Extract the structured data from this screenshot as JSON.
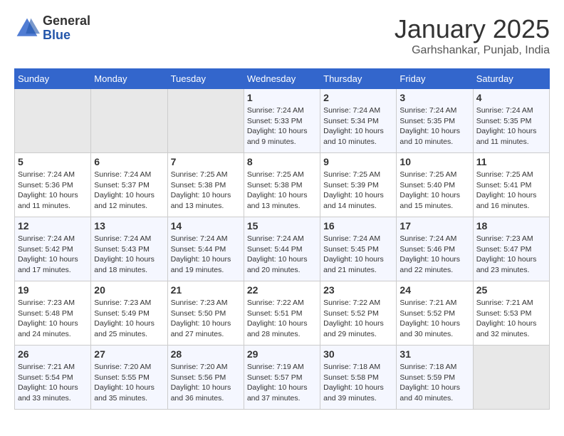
{
  "header": {
    "logo_general": "General",
    "logo_blue": "Blue",
    "month_title": "January 2025",
    "location": "Garhshankar, Punjab, India"
  },
  "days_of_week": [
    "Sunday",
    "Monday",
    "Tuesday",
    "Wednesday",
    "Thursday",
    "Friday",
    "Saturday"
  ],
  "weeks": [
    [
      {
        "day": "",
        "info": ""
      },
      {
        "day": "",
        "info": ""
      },
      {
        "day": "",
        "info": ""
      },
      {
        "day": "1",
        "info": "Sunrise: 7:24 AM\nSunset: 5:33 PM\nDaylight: 10 hours\nand 9 minutes."
      },
      {
        "day": "2",
        "info": "Sunrise: 7:24 AM\nSunset: 5:34 PM\nDaylight: 10 hours\nand 10 minutes."
      },
      {
        "day": "3",
        "info": "Sunrise: 7:24 AM\nSunset: 5:35 PM\nDaylight: 10 hours\nand 10 minutes."
      },
      {
        "day": "4",
        "info": "Sunrise: 7:24 AM\nSunset: 5:35 PM\nDaylight: 10 hours\nand 11 minutes."
      }
    ],
    [
      {
        "day": "5",
        "info": "Sunrise: 7:24 AM\nSunset: 5:36 PM\nDaylight: 10 hours\nand 11 minutes."
      },
      {
        "day": "6",
        "info": "Sunrise: 7:24 AM\nSunset: 5:37 PM\nDaylight: 10 hours\nand 12 minutes."
      },
      {
        "day": "7",
        "info": "Sunrise: 7:25 AM\nSunset: 5:38 PM\nDaylight: 10 hours\nand 13 minutes."
      },
      {
        "day": "8",
        "info": "Sunrise: 7:25 AM\nSunset: 5:38 PM\nDaylight: 10 hours\nand 13 minutes."
      },
      {
        "day": "9",
        "info": "Sunrise: 7:25 AM\nSunset: 5:39 PM\nDaylight: 10 hours\nand 14 minutes."
      },
      {
        "day": "10",
        "info": "Sunrise: 7:25 AM\nSunset: 5:40 PM\nDaylight: 10 hours\nand 15 minutes."
      },
      {
        "day": "11",
        "info": "Sunrise: 7:25 AM\nSunset: 5:41 PM\nDaylight: 10 hours\nand 16 minutes."
      }
    ],
    [
      {
        "day": "12",
        "info": "Sunrise: 7:24 AM\nSunset: 5:42 PM\nDaylight: 10 hours\nand 17 minutes."
      },
      {
        "day": "13",
        "info": "Sunrise: 7:24 AM\nSunset: 5:43 PM\nDaylight: 10 hours\nand 18 minutes."
      },
      {
        "day": "14",
        "info": "Sunrise: 7:24 AM\nSunset: 5:44 PM\nDaylight: 10 hours\nand 19 minutes."
      },
      {
        "day": "15",
        "info": "Sunrise: 7:24 AM\nSunset: 5:44 PM\nDaylight: 10 hours\nand 20 minutes."
      },
      {
        "day": "16",
        "info": "Sunrise: 7:24 AM\nSunset: 5:45 PM\nDaylight: 10 hours\nand 21 minutes."
      },
      {
        "day": "17",
        "info": "Sunrise: 7:24 AM\nSunset: 5:46 PM\nDaylight: 10 hours\nand 22 minutes."
      },
      {
        "day": "18",
        "info": "Sunrise: 7:23 AM\nSunset: 5:47 PM\nDaylight: 10 hours\nand 23 minutes."
      }
    ],
    [
      {
        "day": "19",
        "info": "Sunrise: 7:23 AM\nSunset: 5:48 PM\nDaylight: 10 hours\nand 24 minutes."
      },
      {
        "day": "20",
        "info": "Sunrise: 7:23 AM\nSunset: 5:49 PM\nDaylight: 10 hours\nand 25 minutes."
      },
      {
        "day": "21",
        "info": "Sunrise: 7:23 AM\nSunset: 5:50 PM\nDaylight: 10 hours\nand 27 minutes."
      },
      {
        "day": "22",
        "info": "Sunrise: 7:22 AM\nSunset: 5:51 PM\nDaylight: 10 hours\nand 28 minutes."
      },
      {
        "day": "23",
        "info": "Sunrise: 7:22 AM\nSunset: 5:52 PM\nDaylight: 10 hours\nand 29 minutes."
      },
      {
        "day": "24",
        "info": "Sunrise: 7:21 AM\nSunset: 5:52 PM\nDaylight: 10 hours\nand 30 minutes."
      },
      {
        "day": "25",
        "info": "Sunrise: 7:21 AM\nSunset: 5:53 PM\nDaylight: 10 hours\nand 32 minutes."
      }
    ],
    [
      {
        "day": "26",
        "info": "Sunrise: 7:21 AM\nSunset: 5:54 PM\nDaylight: 10 hours\nand 33 minutes."
      },
      {
        "day": "27",
        "info": "Sunrise: 7:20 AM\nSunset: 5:55 PM\nDaylight: 10 hours\nand 35 minutes."
      },
      {
        "day": "28",
        "info": "Sunrise: 7:20 AM\nSunset: 5:56 PM\nDaylight: 10 hours\nand 36 minutes."
      },
      {
        "day": "29",
        "info": "Sunrise: 7:19 AM\nSunset: 5:57 PM\nDaylight: 10 hours\nand 37 minutes."
      },
      {
        "day": "30",
        "info": "Sunrise: 7:18 AM\nSunset: 5:58 PM\nDaylight: 10 hours\nand 39 minutes."
      },
      {
        "day": "31",
        "info": "Sunrise: 7:18 AM\nSunset: 5:59 PM\nDaylight: 10 hours\nand 40 minutes."
      },
      {
        "day": "",
        "info": ""
      }
    ]
  ]
}
